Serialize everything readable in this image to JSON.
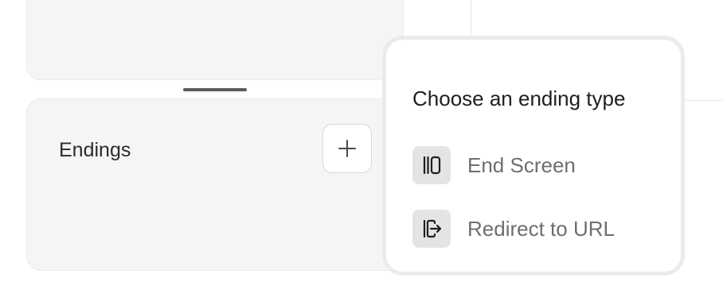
{
  "endings_panel": {
    "label": "Endings",
    "add_icon": "plus-icon"
  },
  "ending_type_popover": {
    "title": "Choose an ending type",
    "options": [
      {
        "label": "End Screen",
        "icon": "end-screen-icon"
      },
      {
        "label": "Redirect to URL",
        "icon": "redirect-url-icon"
      }
    ]
  },
  "colors": {
    "panel_background": "#f6f5f3",
    "icon_tile_background": "#e4e4e2",
    "option_text": "#6e6e6c"
  }
}
